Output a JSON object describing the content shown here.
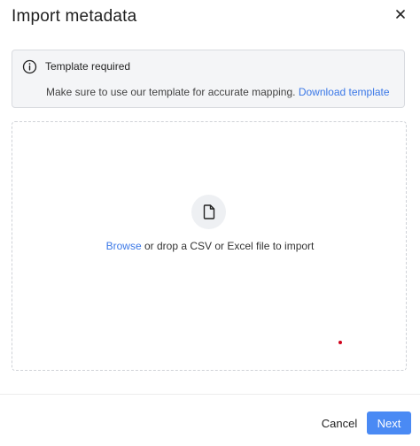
{
  "dialog": {
    "title": "Import metadata",
    "close_icon": "close-icon"
  },
  "notice": {
    "icon": "info-icon",
    "title": "Template required",
    "body": "Make sure to use our template for accurate mapping.",
    "link": "Download template"
  },
  "dropzone": {
    "icon": "file-icon",
    "browse_link": "Browse",
    "text": "or drop a CSV or Excel file to import"
  },
  "footer": {
    "cancel_label": "Cancel",
    "next_label": "Next"
  },
  "colors": {
    "link": "#3b78e7",
    "primary_button": "#4a8af4",
    "notice_bg": "#f4f5f7"
  }
}
